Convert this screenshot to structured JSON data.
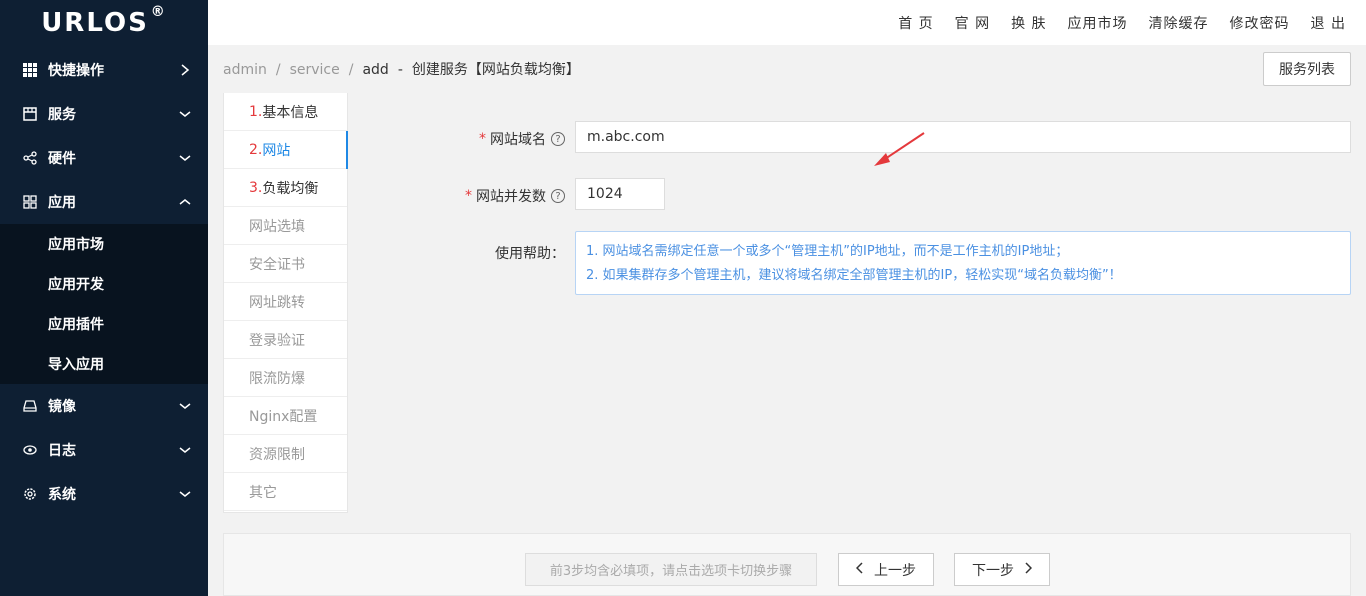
{
  "logo": {
    "text": "URLOS",
    "mark": "®"
  },
  "sidebar": {
    "items": [
      {
        "label": "快捷操作",
        "icon": "grid-icon",
        "chev": "right"
      },
      {
        "label": "服务",
        "icon": "store-icon",
        "chev": "down"
      },
      {
        "label": "硬件",
        "icon": "share-icon",
        "chev": "down"
      },
      {
        "label": "应用",
        "icon": "apps-icon",
        "chev": "up"
      },
      {
        "label": "镜像",
        "icon": "drive-icon",
        "chev": "down"
      },
      {
        "label": "日志",
        "icon": "eye-icon",
        "chev": "down"
      },
      {
        "label": "系统",
        "icon": "gear-icon",
        "chev": "down"
      }
    ],
    "sub_items": [
      "应用市场",
      "应用开发",
      "应用插件",
      "导入应用"
    ]
  },
  "topbar": {
    "links": [
      "首 页",
      "官 网",
      "换 肤",
      "应用市场",
      "清除缓存",
      "修改密码",
      "退 出"
    ]
  },
  "breadcrumb": {
    "parts": [
      "admin",
      "service",
      "add"
    ],
    "current": "创建服务【网站负载均衡】",
    "list_button": "服务列表"
  },
  "steps": [
    {
      "num": "1.",
      "label": "基本信息"
    },
    {
      "num": "2.",
      "label": "网站"
    },
    {
      "num": "3.",
      "label": "负载均衡"
    },
    {
      "num": "",
      "label": "网站选填"
    },
    {
      "num": "",
      "label": "安全证书"
    },
    {
      "num": "",
      "label": "网址跳转"
    },
    {
      "num": "",
      "label": "登录验证"
    },
    {
      "num": "",
      "label": "限流防爆"
    },
    {
      "num": "",
      "label": "Nginx配置"
    },
    {
      "num": "",
      "label": "资源限制"
    },
    {
      "num": "",
      "label": "其它"
    }
  ],
  "form": {
    "domain_label": "网站域名",
    "domain_value": "m.abc.com",
    "concurrency_label": "网站并发数",
    "concurrency_value": "1024",
    "help_label": "使用帮助：",
    "help_lines": [
      "1. 网站域名需绑定任意一个或多个“管理主机”的IP地址，而不是工作主机的IP地址；",
      "2. 如果集群存多个管理主机，建议将域名绑定全部管理主机的IP，轻松实现“域名负载均衡”！"
    ]
  },
  "footer": {
    "hint": "前3步均含必填项，请点击选项卡切换步骤",
    "prev": "上一步",
    "next": "下一步"
  },
  "colors": {
    "sidebar": "#0e1f33",
    "accent": "#1e88e5",
    "required": "#e4393c",
    "help_text": "#4a90e2"
  }
}
